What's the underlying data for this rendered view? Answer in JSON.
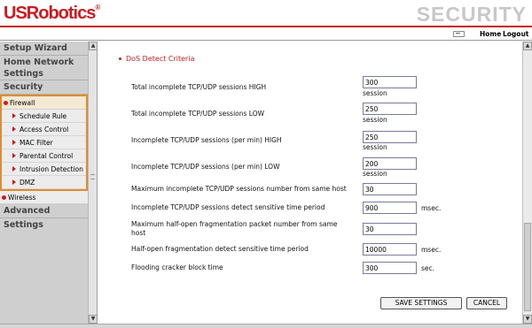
{
  "brand": {
    "logo": "USRobotics",
    "section": "SECURITY"
  },
  "topnav": {
    "home": "Home",
    "logout": "Logout"
  },
  "sidebar": {
    "setup_wizard": "Setup Wizard",
    "home_network": "Home Network Settings",
    "security": "Security",
    "firewall": "Firewall",
    "firewall_items": [
      "Schedule Rule",
      "Access Control",
      "MAC Filter",
      "Parental Control",
      "Intrusion Detection",
      "DMZ"
    ],
    "wireless": "Wireless",
    "advanced": "Advanced Settings"
  },
  "main": {
    "section_title": "DoS Detect Criteria",
    "rows": [
      {
        "label": "Total incomplete TCP/UDP sessions HIGH",
        "value": "300",
        "unit": "session"
      },
      {
        "label": "Total incomplete TCP/UDP sessions LOW",
        "value": "250",
        "unit": "session"
      },
      {
        "label": "Incomplete TCP/UDP sessions (per min) HIGH",
        "value": "250",
        "unit": "session"
      },
      {
        "label": "Incomplete TCP/UDP sessions (per min) LOW",
        "value": "200",
        "unit": "session"
      },
      {
        "label": "Maximum incomplete TCP/UDP sessions number from same host",
        "value": "30",
        "unit": ""
      },
      {
        "label": "Incomplete TCP/UDP sessions detect sensitive time period",
        "value": "900",
        "unit": "msec."
      },
      {
        "label": "Maximum half-open fragmentation packet number from same host",
        "value": "30",
        "unit": ""
      },
      {
        "label": "Half-open fragmentation detect sensitive time period",
        "value": "10000",
        "unit": "msec."
      },
      {
        "label": "Flooding cracker block time",
        "value": "300",
        "unit": "sec."
      }
    ],
    "save_label": "SAVE SETTINGS",
    "cancel_label": "CANCEL"
  },
  "colors": {
    "brand_red": "#d2181e",
    "firewall_outline": "#e28b2c"
  },
  "icons": {
    "nav": "monitor-icon",
    "bullet": "red-dot-icon",
    "submenu": "triangle-right-icon"
  }
}
